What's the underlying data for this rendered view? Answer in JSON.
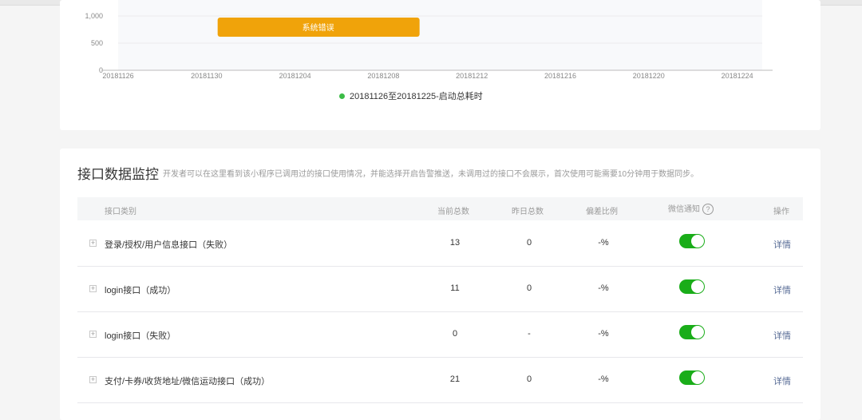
{
  "chart_data": {
    "type": "line",
    "title": "",
    "y_ticks": [
      "1,000",
      "500",
      "0"
    ],
    "ylim": [
      0,
      1000
    ],
    "x_ticks": [
      "20181126",
      "20181130",
      "20181204",
      "20181208",
      "20181212",
      "20181216",
      "20181220",
      "20181224"
    ],
    "series": [
      {
        "name": "20181126至20181225-启动总耗时",
        "color": "#3cbc47",
        "values": []
      }
    ],
    "annotation": {
      "text": "系统错误",
      "from": "20181202",
      "to": "20181211",
      "color": "#f0a30a"
    },
    "grid": true,
    "legend_position": "bottom"
  },
  "api_section": {
    "title": "接口数据监控",
    "description": "开发者可以在这里看到该小程序已调用过的接口使用情况，并能选择开启告警推送，未调用过的接口不会展示，首次使用可能需要10分钟用于数据同步。",
    "headers": {
      "category": "接口类别",
      "current_total": "当前总数",
      "yesterday_total": "昨日总数",
      "deviation": "偏差比例",
      "wechat_notify": "微信通知",
      "action": "操作"
    },
    "help_icon_glyph": "?",
    "expand_glyph": "+",
    "rows": [
      {
        "name": "登录/授权/用户信息接口（失败）",
        "current": "13",
        "yesterday": "0",
        "deviation": "-%",
        "notify_on": true,
        "action": "详情"
      },
      {
        "name": "login接口（成功）",
        "current": "11",
        "yesterday": "0",
        "deviation": "-%",
        "notify_on": true,
        "action": "详情"
      },
      {
        "name": "login接口（失败）",
        "current": "0",
        "yesterday": "-",
        "deviation": "-%",
        "notify_on": true,
        "action": "详情"
      },
      {
        "name": "支付/卡券/收货地址/微信运动接口（成功）",
        "current": "21",
        "yesterday": "0",
        "deviation": "-%",
        "notify_on": true,
        "action": "详情"
      }
    ]
  }
}
